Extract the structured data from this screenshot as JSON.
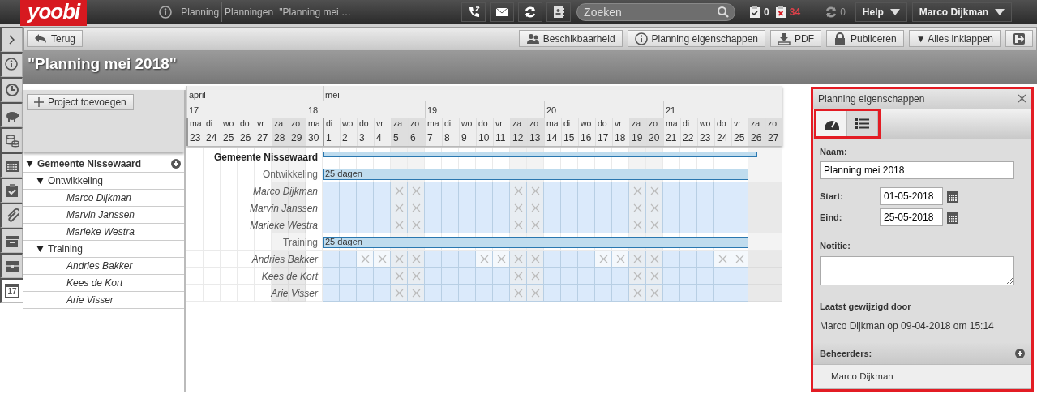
{
  "top_bar": {
    "logo": "yoobi",
    "breadcrumbs": [
      "Planning",
      "Planningen",
      "\"Planning mei …"
    ],
    "search": {
      "placeholder": "Zoeken"
    },
    "counters": [
      {
        "kind": "done",
        "value": "0"
      },
      {
        "kind": "overdue",
        "value": "34"
      }
    ],
    "sync_count": "0",
    "menus": [
      "Help",
      "Marco Dijkman"
    ]
  },
  "left_rail": {
    "items": [
      {
        "selected": false
      },
      {
        "selected": false
      },
      {
        "selected": false
      },
      {
        "selected": false
      },
      {
        "selected": false
      },
      {
        "selected": false
      },
      {
        "selected": false
      },
      {
        "selected": false
      },
      {
        "selected": false
      },
      {
        "selected": false
      },
      {
        "selected": true
      }
    ],
    "calendar_day": "17"
  },
  "toolbar": {
    "back": "Terug",
    "buttons": [
      {
        "kind": "availability",
        "label": "Beschikbaarheid"
      },
      {
        "kind": "info",
        "label": "Planning eigenschappen"
      },
      {
        "kind": "pdf",
        "label": "PDF"
      },
      {
        "kind": "lock",
        "label": "Publiceren"
      },
      {
        "kind": "plain",
        "label": "▼ Alles inklappen"
      },
      {
        "kind": "exit"
      }
    ]
  },
  "page_title": "\"Planning mei 2018\"",
  "tree": {
    "add_button": "Project toevoegen",
    "items": [
      {
        "label": "Gemeente Nissewaard",
        "expanded": true,
        "children": [
          {
            "label": "Ontwikkeling",
            "expanded": true,
            "children": [
              {
                "label": "Marco Dijkman"
              },
              {
                "label": "Marvin Janssen"
              },
              {
                "label": "Marieke Westra"
              }
            ]
          },
          {
            "label": "Training",
            "expanded": true,
            "children": [
              {
                "label": "Andries Bakker"
              },
              {
                "label": "Kees de Kort"
              },
              {
                "label": "Arie Visser"
              }
            ]
          }
        ]
      }
    ]
  },
  "timeline": {
    "months": [
      "april",
      "mei"
    ],
    "weeks": [
      {
        "label": "17",
        "days": [
          {
            "name": "ma",
            "num": "23",
            "weekend": false,
            "new_month": true
          },
          {
            "name": "di",
            "num": "24",
            "weekend": false,
            "new_month": false
          },
          {
            "name": "wo",
            "num": "25",
            "weekend": false,
            "new_month": false
          },
          {
            "name": "do",
            "num": "26",
            "weekend": false,
            "new_month": false
          },
          {
            "name": "vr",
            "num": "27",
            "weekend": false,
            "new_month": false
          },
          {
            "name": "za",
            "num": "28",
            "weekend": true,
            "new_month": false
          },
          {
            "name": "zo",
            "num": "29",
            "weekend": true,
            "new_month": false
          }
        ]
      },
      {
        "label": "18",
        "days": [
          {
            "name": "ma",
            "num": "30",
            "weekend": false,
            "new_month": false
          },
          {
            "name": "di",
            "num": "1",
            "weekend": false,
            "new_month": true
          },
          {
            "name": "wo",
            "num": "2",
            "weekend": false,
            "new_month": false
          },
          {
            "name": "do",
            "num": "3",
            "weekend": false,
            "new_month": false
          },
          {
            "name": "vr",
            "num": "4",
            "weekend": false,
            "new_month": false
          },
          {
            "name": "za",
            "num": "5",
            "weekend": true,
            "new_month": false
          },
          {
            "name": "zo",
            "num": "6",
            "weekend": true,
            "new_month": false
          }
        ]
      },
      {
        "label": "19",
        "days": [
          {
            "name": "ma",
            "num": "7",
            "weekend": false,
            "new_month": false
          },
          {
            "name": "di",
            "num": "8",
            "weekend": false,
            "new_month": false
          },
          {
            "name": "wo",
            "num": "9",
            "weekend": false,
            "new_month": false
          },
          {
            "name": "do",
            "num": "10",
            "weekend": false,
            "new_month": false
          },
          {
            "name": "vr",
            "num": "11",
            "weekend": false,
            "new_month": false
          },
          {
            "name": "za",
            "num": "12",
            "weekend": true,
            "new_month": false
          },
          {
            "name": "zo",
            "num": "13",
            "weekend": true,
            "new_month": false
          }
        ]
      },
      {
        "label": "20",
        "days": [
          {
            "name": "ma",
            "num": "14",
            "weekend": false,
            "new_month": false
          },
          {
            "name": "di",
            "num": "15",
            "weekend": false,
            "new_month": false
          },
          {
            "name": "wo",
            "num": "16",
            "weekend": false,
            "new_month": false
          },
          {
            "name": "do",
            "num": "17",
            "weekend": false,
            "new_month": false
          },
          {
            "name": "vr",
            "num": "18",
            "weekend": false,
            "new_month": false
          },
          {
            "name": "za",
            "num": "19",
            "weekend": true,
            "new_month": false
          },
          {
            "name": "zo",
            "num": "20",
            "weekend": true,
            "new_month": false
          }
        ]
      },
      {
        "label": "21",
        "days": [
          {
            "name": "ma",
            "num": "21",
            "weekend": false,
            "new_month": false
          },
          {
            "name": "di",
            "num": "22",
            "weekend": false,
            "new_month": false
          },
          {
            "name": "wo",
            "num": "23",
            "weekend": false,
            "new_month": false
          },
          {
            "name": "do",
            "num": "24",
            "weekend": false,
            "new_month": false
          },
          {
            "name": "vr",
            "num": "25",
            "weekend": false,
            "new_month": false
          },
          {
            "name": "za",
            "num": "26",
            "weekend": true,
            "new_month": false
          },
          {
            "name": "zo",
            "num": "27",
            "weekend": true,
            "new_month": false
          }
        ]
      }
    ]
  },
  "gantt": {
    "rows": [
      {
        "kind": "project",
        "label": "Gemeente Nissewaard"
      },
      {
        "kind": "group",
        "label": "Ontwikkeling",
        "bar_label": "25 dagen"
      },
      {
        "kind": "person",
        "label": "Marco Dijkman",
        "cells": [
          {
            "planned": false,
            "off": false
          },
          {
            "planned": false,
            "off": false
          },
          {
            "planned": false,
            "off": false
          },
          {
            "planned": false,
            "off": false
          },
          {
            "planned": false,
            "off": false
          },
          {
            "planned": false,
            "off": false
          },
          {
            "planned": false,
            "off": false
          },
          {
            "planned": false,
            "off": false
          },
          {
            "planned": true,
            "off": false
          },
          {
            "planned": true,
            "off": false
          },
          {
            "planned": true,
            "off": false
          },
          {
            "planned": true,
            "off": false
          },
          {
            "planned": true,
            "off": true
          },
          {
            "planned": true,
            "off": true
          },
          {
            "planned": true,
            "off": false
          },
          {
            "planned": true,
            "off": false
          },
          {
            "planned": true,
            "off": false
          },
          {
            "planned": true,
            "off": false
          },
          {
            "planned": true,
            "off": false
          },
          {
            "planned": true,
            "off": true
          },
          {
            "planned": true,
            "off": true
          },
          {
            "planned": true,
            "off": false
          },
          {
            "planned": true,
            "off": false
          },
          {
            "planned": true,
            "off": false
          },
          {
            "planned": true,
            "off": false
          },
          {
            "planned": true,
            "off": false
          },
          {
            "planned": true,
            "off": true
          },
          {
            "planned": true,
            "off": true
          },
          {
            "planned": true,
            "off": false
          },
          {
            "planned": true,
            "off": false
          },
          {
            "planned": true,
            "off": false
          },
          {
            "planned": true,
            "off": false
          },
          {
            "planned": true,
            "off": false
          },
          {
            "planned": false,
            "off": false
          },
          {
            "planned": false,
            "off": false
          }
        ]
      },
      {
        "kind": "person",
        "label": "Marvin Janssen",
        "cells": [
          {
            "planned": false,
            "off": false
          },
          {
            "planned": false,
            "off": false
          },
          {
            "planned": false,
            "off": false
          },
          {
            "planned": false,
            "off": false
          },
          {
            "planned": false,
            "off": false
          },
          {
            "planned": false,
            "off": false
          },
          {
            "planned": false,
            "off": false
          },
          {
            "planned": false,
            "off": false
          },
          {
            "planned": true,
            "off": false
          },
          {
            "planned": true,
            "off": false
          },
          {
            "planned": true,
            "off": false
          },
          {
            "planned": true,
            "off": false
          },
          {
            "planned": true,
            "off": true
          },
          {
            "planned": true,
            "off": true
          },
          {
            "planned": true,
            "off": false
          },
          {
            "planned": true,
            "off": false
          },
          {
            "planned": true,
            "off": false
          },
          {
            "planned": true,
            "off": false
          },
          {
            "planned": true,
            "off": false
          },
          {
            "planned": true,
            "off": true
          },
          {
            "planned": true,
            "off": true
          },
          {
            "planned": true,
            "off": false
          },
          {
            "planned": true,
            "off": false
          },
          {
            "planned": true,
            "off": false
          },
          {
            "planned": true,
            "off": false
          },
          {
            "planned": true,
            "off": false
          },
          {
            "planned": true,
            "off": true
          },
          {
            "planned": true,
            "off": true
          },
          {
            "planned": true,
            "off": false
          },
          {
            "planned": true,
            "off": false
          },
          {
            "planned": true,
            "off": false
          },
          {
            "planned": true,
            "off": false
          },
          {
            "planned": true,
            "off": false
          },
          {
            "planned": false,
            "off": false
          },
          {
            "planned": false,
            "off": false
          }
        ]
      },
      {
        "kind": "person",
        "label": "Marieke Westra",
        "cells": [
          {
            "planned": false,
            "off": false
          },
          {
            "planned": false,
            "off": false
          },
          {
            "planned": false,
            "off": false
          },
          {
            "planned": false,
            "off": false
          },
          {
            "planned": false,
            "off": false
          },
          {
            "planned": false,
            "off": false
          },
          {
            "planned": false,
            "off": false
          },
          {
            "planned": false,
            "off": false
          },
          {
            "planned": true,
            "off": false
          },
          {
            "planned": true,
            "off": false
          },
          {
            "planned": true,
            "off": false
          },
          {
            "planned": true,
            "off": false
          },
          {
            "planned": true,
            "off": true
          },
          {
            "planned": true,
            "off": true
          },
          {
            "planned": true,
            "off": false
          },
          {
            "planned": true,
            "off": false
          },
          {
            "planned": true,
            "off": false
          },
          {
            "planned": true,
            "off": false
          },
          {
            "planned": true,
            "off": false
          },
          {
            "planned": true,
            "off": true
          },
          {
            "planned": true,
            "off": true
          },
          {
            "planned": true,
            "off": false
          },
          {
            "planned": true,
            "off": false
          },
          {
            "planned": true,
            "off": false
          },
          {
            "planned": true,
            "off": false
          },
          {
            "planned": true,
            "off": false
          },
          {
            "planned": true,
            "off": true
          },
          {
            "planned": true,
            "off": true
          },
          {
            "planned": true,
            "off": false
          },
          {
            "planned": true,
            "off": false
          },
          {
            "planned": true,
            "off": false
          },
          {
            "planned": true,
            "off": false
          },
          {
            "planned": true,
            "off": false
          },
          {
            "planned": false,
            "off": false
          },
          {
            "planned": false,
            "off": false
          }
        ]
      },
      {
        "kind": "group",
        "label": "Training",
        "bar_label": "25 dagen"
      },
      {
        "kind": "person",
        "label": "Andries Bakker",
        "cells": [
          {
            "planned": false,
            "off": false
          },
          {
            "planned": false,
            "off": false
          },
          {
            "planned": false,
            "off": false
          },
          {
            "planned": false,
            "off": false
          },
          {
            "planned": false,
            "off": false
          },
          {
            "planned": false,
            "off": false
          },
          {
            "planned": false,
            "off": false
          },
          {
            "planned": false,
            "off": false
          },
          {
            "planned": true,
            "off": false
          },
          {
            "planned": true,
            "off": false
          },
          {
            "planned": true,
            "off": true
          },
          {
            "planned": true,
            "off": true
          },
          {
            "planned": true,
            "off": true
          },
          {
            "planned": true,
            "off": true
          },
          {
            "planned": true,
            "off": false
          },
          {
            "planned": true,
            "off": false
          },
          {
            "planned": true,
            "off": false
          },
          {
            "planned": true,
            "off": true
          },
          {
            "planned": true,
            "off": true
          },
          {
            "planned": true,
            "off": true
          },
          {
            "planned": true,
            "off": true
          },
          {
            "planned": true,
            "off": false
          },
          {
            "planned": true,
            "off": false
          },
          {
            "planned": true,
            "off": false
          },
          {
            "planned": true,
            "off": true
          },
          {
            "planned": true,
            "off": true
          },
          {
            "planned": true,
            "off": true
          },
          {
            "planned": true,
            "off": true
          },
          {
            "planned": true,
            "off": false
          },
          {
            "planned": true,
            "off": false
          },
          {
            "planned": true,
            "off": false
          },
          {
            "planned": true,
            "off": true
          },
          {
            "planned": true,
            "off": true
          },
          {
            "planned": false,
            "off": false
          },
          {
            "planned": false,
            "off": false
          }
        ]
      },
      {
        "kind": "person",
        "label": "Kees de Kort",
        "cells": [
          {
            "planned": false,
            "off": false
          },
          {
            "planned": false,
            "off": false
          },
          {
            "planned": false,
            "off": false
          },
          {
            "planned": false,
            "off": false
          },
          {
            "planned": false,
            "off": false
          },
          {
            "planned": false,
            "off": false
          },
          {
            "planned": false,
            "off": false
          },
          {
            "planned": false,
            "off": false
          },
          {
            "planned": true,
            "off": false
          },
          {
            "planned": true,
            "off": false
          },
          {
            "planned": true,
            "off": false
          },
          {
            "planned": true,
            "off": false
          },
          {
            "planned": true,
            "off": true
          },
          {
            "planned": true,
            "off": true
          },
          {
            "planned": true,
            "off": false
          },
          {
            "planned": true,
            "off": false
          },
          {
            "planned": true,
            "off": false
          },
          {
            "planned": true,
            "off": false
          },
          {
            "planned": true,
            "off": false
          },
          {
            "planned": true,
            "off": true
          },
          {
            "planned": true,
            "off": true
          },
          {
            "planned": true,
            "off": false
          },
          {
            "planned": true,
            "off": false
          },
          {
            "planned": true,
            "off": false
          },
          {
            "planned": true,
            "off": false
          },
          {
            "planned": true,
            "off": false
          },
          {
            "planned": true,
            "off": true
          },
          {
            "planned": true,
            "off": true
          },
          {
            "planned": true,
            "off": false
          },
          {
            "planned": true,
            "off": false
          },
          {
            "planned": true,
            "off": false
          },
          {
            "planned": true,
            "off": false
          },
          {
            "planned": true,
            "off": false
          },
          {
            "planned": false,
            "off": false
          },
          {
            "planned": false,
            "off": false
          }
        ]
      },
      {
        "kind": "person",
        "label": "Arie Visser",
        "cells": [
          {
            "planned": false,
            "off": false
          },
          {
            "planned": false,
            "off": false
          },
          {
            "planned": false,
            "off": false
          },
          {
            "planned": false,
            "off": false
          },
          {
            "planned": false,
            "off": false
          },
          {
            "planned": false,
            "off": false
          },
          {
            "planned": false,
            "off": false
          },
          {
            "planned": false,
            "off": false
          },
          {
            "planned": true,
            "off": false
          },
          {
            "planned": true,
            "off": false
          },
          {
            "planned": true,
            "off": false
          },
          {
            "planned": true,
            "off": false
          },
          {
            "planned": true,
            "off": true
          },
          {
            "planned": true,
            "off": true
          },
          {
            "planned": true,
            "off": false
          },
          {
            "planned": true,
            "off": false
          },
          {
            "planned": true,
            "off": false
          },
          {
            "planned": true,
            "off": false
          },
          {
            "planned": true,
            "off": false
          },
          {
            "planned": true,
            "off": true
          },
          {
            "planned": true,
            "off": true
          },
          {
            "planned": true,
            "off": false
          },
          {
            "planned": true,
            "off": false
          },
          {
            "planned": true,
            "off": false
          },
          {
            "planned": true,
            "off": false
          },
          {
            "planned": true,
            "off": false
          },
          {
            "planned": true,
            "off": true
          },
          {
            "planned": true,
            "off": true
          },
          {
            "planned": true,
            "off": false
          },
          {
            "planned": true,
            "off": false
          },
          {
            "planned": true,
            "off": false
          },
          {
            "planned": true,
            "off": false
          },
          {
            "planned": true,
            "off": false
          },
          {
            "planned": false,
            "off": false
          },
          {
            "planned": false,
            "off": false
          }
        ]
      }
    ]
  },
  "properties": {
    "title": "Planning eigenschappen",
    "tabs": [
      {
        "selected": true
      },
      {
        "selected": false
      }
    ],
    "name": {
      "label": "Naam:",
      "value": "Planning mei 2018"
    },
    "start": {
      "label": "Start:",
      "value": "01-05-2018"
    },
    "end": {
      "label": "Eind:",
      "value": "25-05-2018"
    },
    "note": {
      "label": "Notitie:"
    },
    "modified": {
      "label": "Laatst gewijzigd door",
      "text": "Marco Dijkman op 09-04-2018 om 15:14"
    },
    "managers": {
      "label": "Beheerders:",
      "items": [
        "Marco Dijkman"
      ]
    }
  }
}
